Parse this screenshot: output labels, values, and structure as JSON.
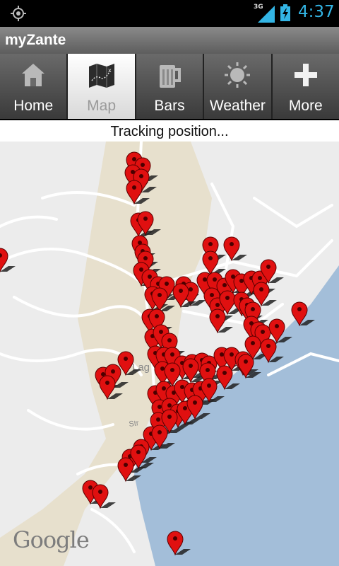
{
  "status_bar": {
    "network_label": "3G",
    "time": "4:37",
    "icons": [
      "gps-icon",
      "signal-icon",
      "battery-charging-icon"
    ]
  },
  "title_bar": {
    "title": "myZante"
  },
  "tabs": [
    {
      "label": "Home",
      "icon": "home-icon",
      "active": false
    },
    {
      "label": "Map",
      "icon": "map-icon",
      "active": true
    },
    {
      "label": "Bars",
      "icon": "beer-mug-icon",
      "active": false
    },
    {
      "label": "Weather",
      "icon": "sun-icon",
      "active": false
    },
    {
      "label": "More",
      "icon": "plus-icon",
      "active": false
    }
  ],
  "tracking_status": "Tracking position...",
  "map": {
    "attribution": "Google",
    "partial_labels": [
      "Lag",
      "Str"
    ],
    "colors": {
      "land": "#ececec",
      "sea": "#a3bed9",
      "beach": "#e6dfcc",
      "roads": "#ffffff",
      "marker": "#e01010"
    }
  }
}
